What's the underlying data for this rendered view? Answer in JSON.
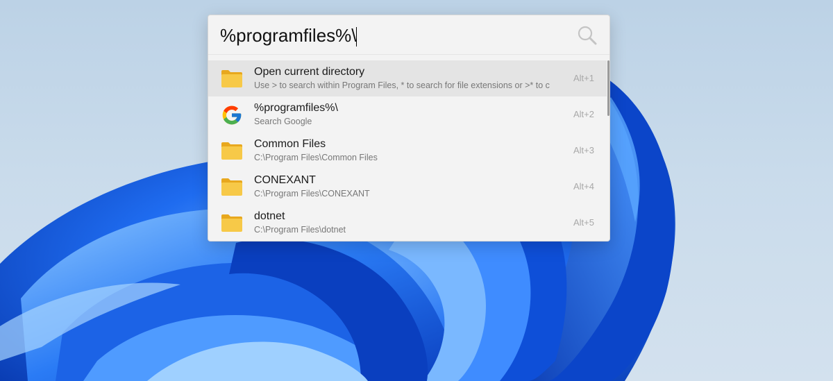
{
  "search": {
    "query": "%programfiles%\\"
  },
  "results": [
    {
      "icon": "folder-icon",
      "title": "Open current directory",
      "subtitle": "Use > to search within Program Files, * to search for file extensions or >* to c",
      "hotkey": "Alt+1",
      "selected": true
    },
    {
      "icon": "google-icon",
      "title": "%programfiles%\\",
      "subtitle": "Search Google",
      "hotkey": "Alt+2",
      "selected": false
    },
    {
      "icon": "folder-icon",
      "title": "Common Files",
      "subtitle": "C:\\Program Files\\Common Files",
      "hotkey": "Alt+3",
      "selected": false
    },
    {
      "icon": "folder-icon",
      "title": "CONEXANT",
      "subtitle": "C:\\Program Files\\CONEXANT",
      "hotkey": "Alt+4",
      "selected": false
    },
    {
      "icon": "folder-icon",
      "title": "dotnet",
      "subtitle": "C:\\Program Files\\dotnet",
      "hotkey": "Alt+5",
      "selected": false
    }
  ],
  "colors": {
    "wallpaper_bloom": "#0a4fd6",
    "panel_background": "#f3f3f3",
    "selected_row": "#e4e4e4",
    "folder": "#f7c948"
  }
}
